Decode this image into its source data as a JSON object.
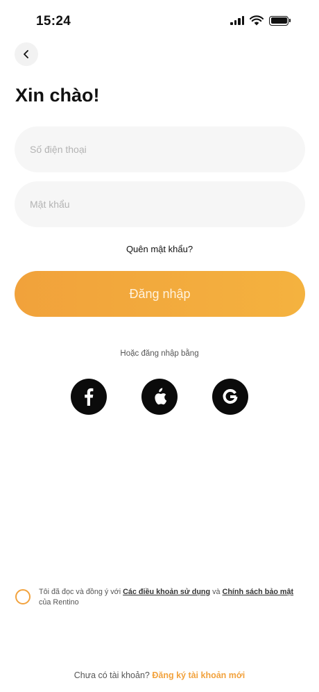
{
  "status_bar": {
    "time": "15:24",
    "icons": [
      "signal-icon",
      "wifi-icon",
      "battery-icon"
    ]
  },
  "header": {
    "back_icon": "chevron-left-icon",
    "title": "Xin chào!"
  },
  "form": {
    "phone_placeholder": "Số điện thoại",
    "phone_value": "",
    "password_placeholder": "Mật khẩu",
    "password_value": "",
    "forgot_label": "Quên mật khẩu?",
    "login_label": "Đăng nhập"
  },
  "social": {
    "label": "Hoặc đăng nhập bằng",
    "providers": [
      "facebook-icon",
      "apple-icon",
      "google-icon"
    ]
  },
  "terms": {
    "checked": false,
    "prefix": "Tôi đã đọc và đồng ý với",
    "terms_link": "Các điều khoản sử dụng",
    "and": "và",
    "privacy_link": "Chính sách bảo mật",
    "suffix": "của Rentino"
  },
  "signup": {
    "prompt": "Chưa có tài khoản?",
    "link": "Đăng ký tài khoản mới"
  },
  "colors": {
    "accent": "#f2a23d",
    "field_bg": "#f6f6f6",
    "text": "#111111"
  }
}
